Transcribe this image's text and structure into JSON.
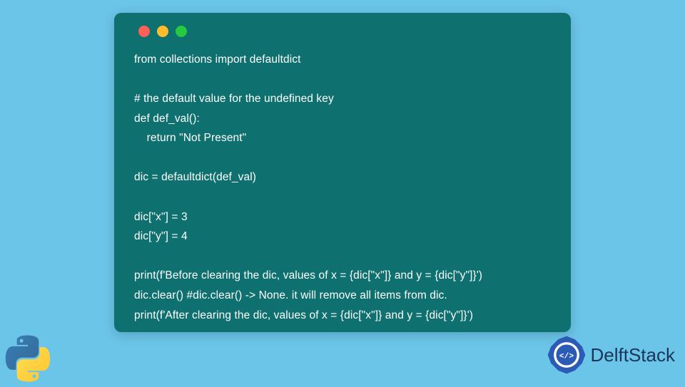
{
  "code": {
    "lines": [
      "from collections import defaultdict",
      "",
      "# the default value for the undefined key",
      "def def_val():",
      "    return \"Not Present\"",
      "",
      "dic = defaultdict(def_val)",
      "",
      "dic[\"x\"] = 3",
      "dic[\"y\"] = 4",
      "",
      "print(f'Before clearing the dic, values of x = {dic[\"x\"]} and y = {dic[\"y\"]}')",
      "dic.clear() #dic.clear() -> None. it will remove all items from dic.",
      "print(f'After clearing the dic, values of x = {dic[\"x\"]} and y = {dic[\"y\"]}')"
    ]
  },
  "brand": {
    "name": "DelftStack"
  },
  "icons": {
    "python": "python-logo",
    "delft": "delft-gear-icon"
  }
}
